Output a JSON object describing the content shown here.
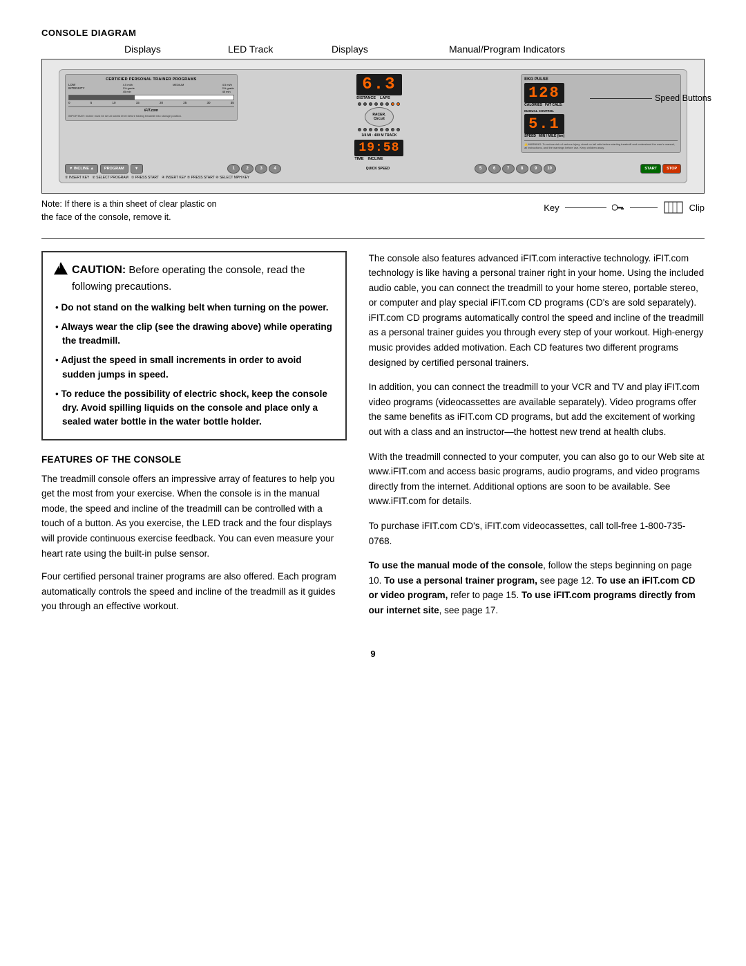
{
  "consoleDiagram": {
    "title": "CONSOLE DIAGRAM",
    "topLabels": {
      "displays1": "Displays",
      "ledTrack": "LED Track",
      "displays2": "Displays",
      "manualProgram": "Manual/Program Indicators"
    },
    "displayNumbers": {
      "large1": "6.3",
      "time": "19:58",
      "calories": "128",
      "speed": "5.1"
    },
    "displayLabels": {
      "distance": "DISTANCE",
      "laps": "LAPS",
      "time": "TIME",
      "incline": "INCLINE",
      "track": "1/4 MI · 400 M TRACK",
      "calories": "CALORIES",
      "fatCals": "FAT CALS.",
      "speed": "SPEED",
      "minMile": "MIN / MILE (km)"
    },
    "speedButtonsLabel": "Speed Buttons",
    "noteText": "Note: If there is a thin sheet of clear plastic on the face of the console, remove it.",
    "keyLabel": "Key",
    "clipLabel": "Clip"
  },
  "caution": {
    "triangleLabel": "!",
    "title": "CAUTION:",
    "headerText": "Before operating the console, read the following precautions.",
    "items": [
      {
        "boldPart": "Do not stand on the walking belt when turning on the power.",
        "restPart": ""
      },
      {
        "boldPart": "Always wear the clip (see the drawing above) while operating the treadmill.",
        "restPart": ""
      },
      {
        "boldPart": "Adjust the speed in small increments in order to avoid sudden jumps in speed.",
        "restPart": ""
      },
      {
        "boldPart": "To reduce the possibility of electric shock, keep the console dry. Avoid spilling liquids on the console and place only a sealed water bottle in the water bottle holder.",
        "restPart": ""
      }
    ]
  },
  "featuresSection": {
    "title": "FEATURES OF THE CONSOLE",
    "paragraph1": "The treadmill console offers an impressive array of features to help you get the most from your exercise. When the console is in the manual mode, the speed and incline of the treadmill can be controlled with a touch of a button. As you exercise, the LED track and the four displays will provide continuous exercise feedback. You can even measure your heart rate using the built-in pulse sensor.",
    "paragraph2": "Four certified personal trainer programs are also offered. Each program automatically controls the speed and incline of the treadmill as it guides you through an effective workout."
  },
  "rightColumn": {
    "paragraph1": "The console also features advanced iFIT.com interactive technology. iFIT.com technology is like having a personal trainer right in your home. Using the included audio cable, you can connect the treadmill to your home stereo, portable stereo, or computer and play special iFIT.com CD programs (CD's are sold separately). iFIT.com CD programs automatically control the speed and incline of the treadmill as a personal trainer guides you through every step of your workout. High-energy music provides added motivation. Each CD features two different programs designed by certified personal trainers.",
    "paragraph2": "In addition, you can connect the treadmill to your VCR and TV and play iFIT.com video programs (videocassettes are available separately). Video programs offer the same benefits as iFIT.com CD programs, but add the excitement of working out with a class and an instructor—the hottest new trend at health clubs.",
    "paragraph3": "With the treadmill connected to your computer, you can also go to our Web site at www.iFIT.com and access basic programs, audio programs, and video programs directly from the internet. Additional options are soon to be available. See www.iFIT.com for details.",
    "paragraph4": "To purchase iFIT.com CD's, iFIT.com videocassettes, call toll-free 1-800-735-0768.",
    "paragraph5Parts": {
      "bold1": "To use the manual mode of the console",
      "text1": ", follow the steps beginning on page 10. ",
      "bold2": "To use a personal trainer program,",
      "text2": " see page 12. ",
      "bold3": "To use an iFIT.com CD or video program,",
      "text3": " refer to page 15. ",
      "bold4": "To use iFIT.com programs directly from our internet site",
      "text4": ", see page 17."
    }
  },
  "pageNumber": "9"
}
